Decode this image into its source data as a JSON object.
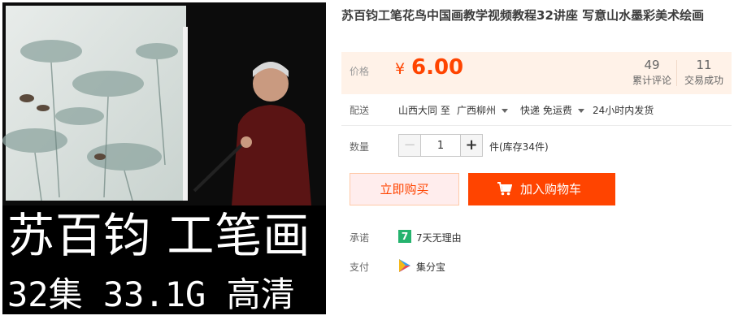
{
  "product": {
    "title": "苏百钧工笔花鸟中国画教学视频教程32讲座 写意山水墨彩美术绘画",
    "image": {
      "overlay_line1": "苏百钧 工笔画",
      "overlay_line2": "32集 33.1G 高清"
    }
  },
  "price": {
    "label": "价格",
    "currency_symbol": "¥",
    "value": "6.00",
    "reviews_count": "49",
    "reviews_label": "累计评论",
    "sales_count": "11",
    "sales_label": "交易成功"
  },
  "shipping": {
    "label": "配送",
    "from": "山西大同 至",
    "to": "广西柳州",
    "method": "快递 免运费",
    "dispatch": "24小时内发货"
  },
  "quantity": {
    "label": "数量",
    "minus": "−",
    "value": "1",
    "plus": "+",
    "stock_text": "件(库存34件)"
  },
  "actions": {
    "buy_now": "立即购买",
    "add_to_cart": "加入购物车"
  },
  "promise": {
    "label": "承诺",
    "badge": "7",
    "text": "7天无理由"
  },
  "payment": {
    "label": "支付",
    "method": "集分宝"
  },
  "colors": {
    "accent": "#ff4400",
    "price_bg": "#fff2e8",
    "promise_green": "#25b36e"
  },
  "icons": {
    "cart": "shopping-cart-icon",
    "promise": "seven-day-return-icon",
    "payment": "jifenbao-icon",
    "dropdown": "caret-down-icon"
  }
}
